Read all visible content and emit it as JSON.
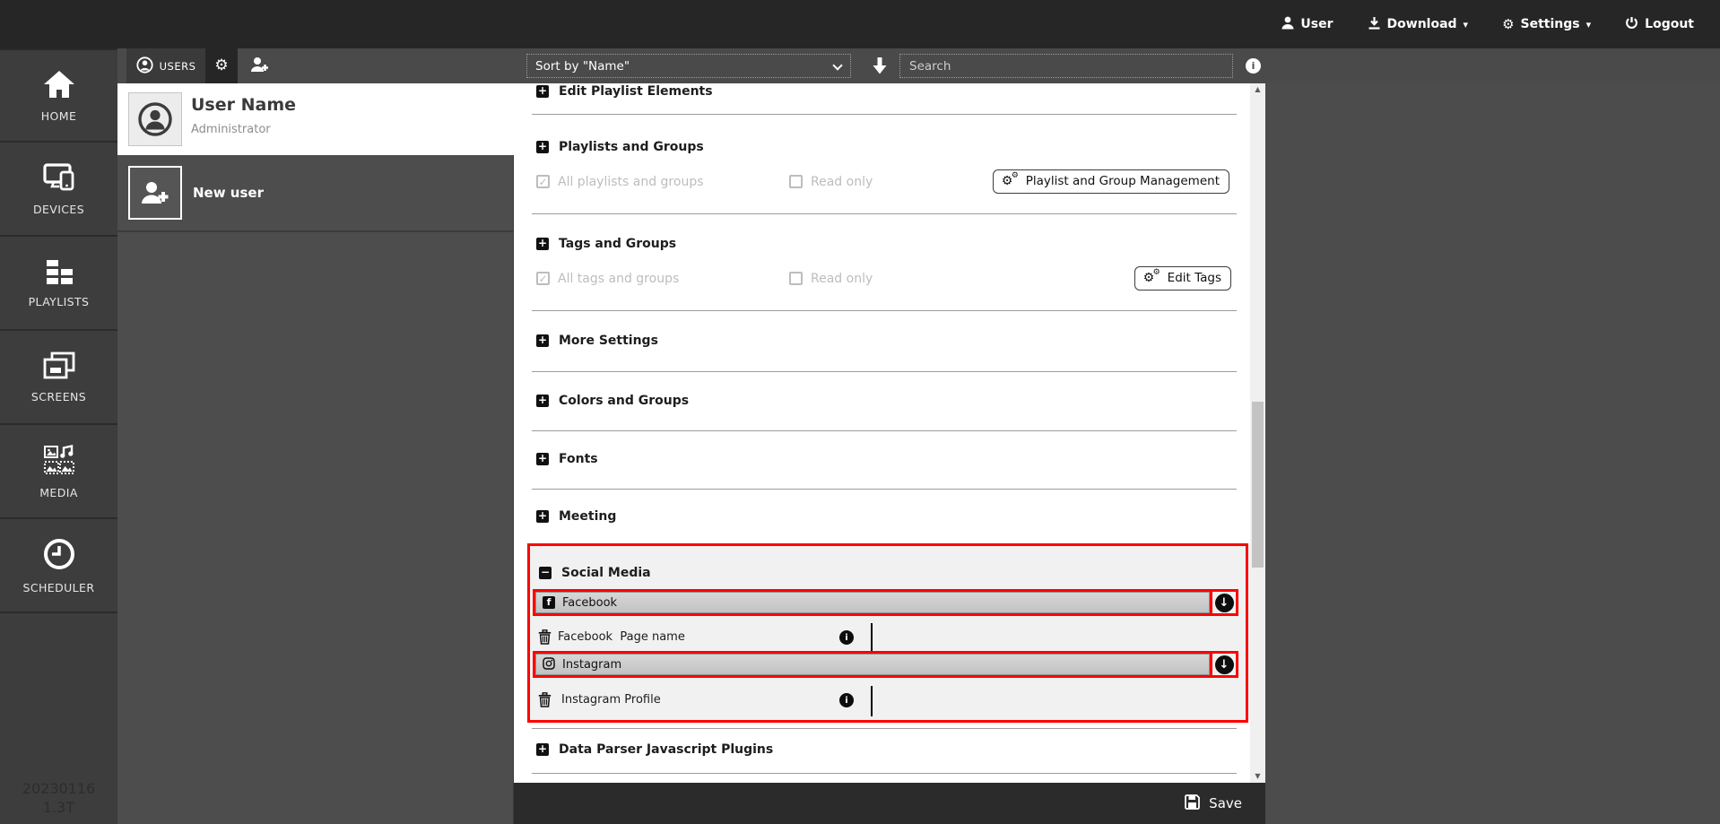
{
  "topbar": {
    "user": "User",
    "download": "Download",
    "settings": "Settings",
    "logout": "Logout"
  },
  "tabbar": {
    "users": "USERS",
    "sort": "Sort by \"Name\"",
    "search_placeholder": "Search"
  },
  "sidebar": {
    "items": [
      {
        "label": "HOME"
      },
      {
        "label": "DEVICES"
      },
      {
        "label": "PLAYLISTS"
      },
      {
        "label": "SCREENS"
      },
      {
        "label": "MEDIA"
      },
      {
        "label": "SCHEDULER"
      }
    ],
    "version": "20230116",
    "build": "1.3T"
  },
  "user_panel": {
    "name": "User Name",
    "role": "Administrator",
    "new_user": "New user"
  },
  "sections": {
    "edit_playlist_elements": "Edit Playlist Elements",
    "playlists_and_groups": "Playlists and Groups",
    "all_playlists": "All playlists and groups",
    "read_only_1": "Read only",
    "playlist_mgmt_button": "Playlist and Group Management",
    "tags_and_groups": "Tags and Groups",
    "all_tags": "All tags and groups",
    "read_only_2": "Read only",
    "edit_tags_button": "Edit Tags",
    "more_settings": "More Settings",
    "colors_and_groups": "Colors and Groups",
    "fonts": "Fonts",
    "meeting": "Meeting",
    "social_media": "Social Media",
    "facebook": "Facebook",
    "facebook_field": "Facebook  Page name",
    "instagram": "Instagram",
    "instagram_field": "Instagram Profile",
    "data_parser": "Data Parser Javascript Plugins"
  },
  "savebar": {
    "save": "Save"
  },
  "icons": {
    "expand_glyph": "+",
    "collapse_glyph": "−",
    "check_glyph": "✓",
    "gear_glyph": "⚙",
    "caret_glyph": "▾",
    "arrow_down_glyph": "↓",
    "info_glyph": "i",
    "facebook_glyph": "f"
  },
  "colors": {
    "annotation_red": "#ff0000",
    "topbar_bg": "#262626",
    "sidebar_bg": "#3d3d3d",
    "panel_bg": "#4d4d4d"
  }
}
